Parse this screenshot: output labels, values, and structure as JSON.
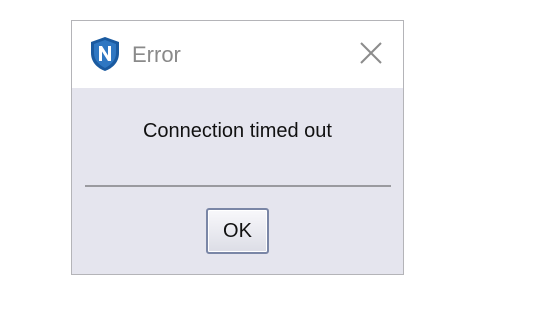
{
  "dialog": {
    "title": "Error",
    "app_icon": "shield-n-logo-icon",
    "close_icon": "close-icon",
    "message": "Connection timed out",
    "ok_label": "OK"
  },
  "colors": {
    "icon_blue": "#1a5aa0",
    "dialog_body": "#e5e5ee",
    "title_text": "#8a8a8a"
  }
}
